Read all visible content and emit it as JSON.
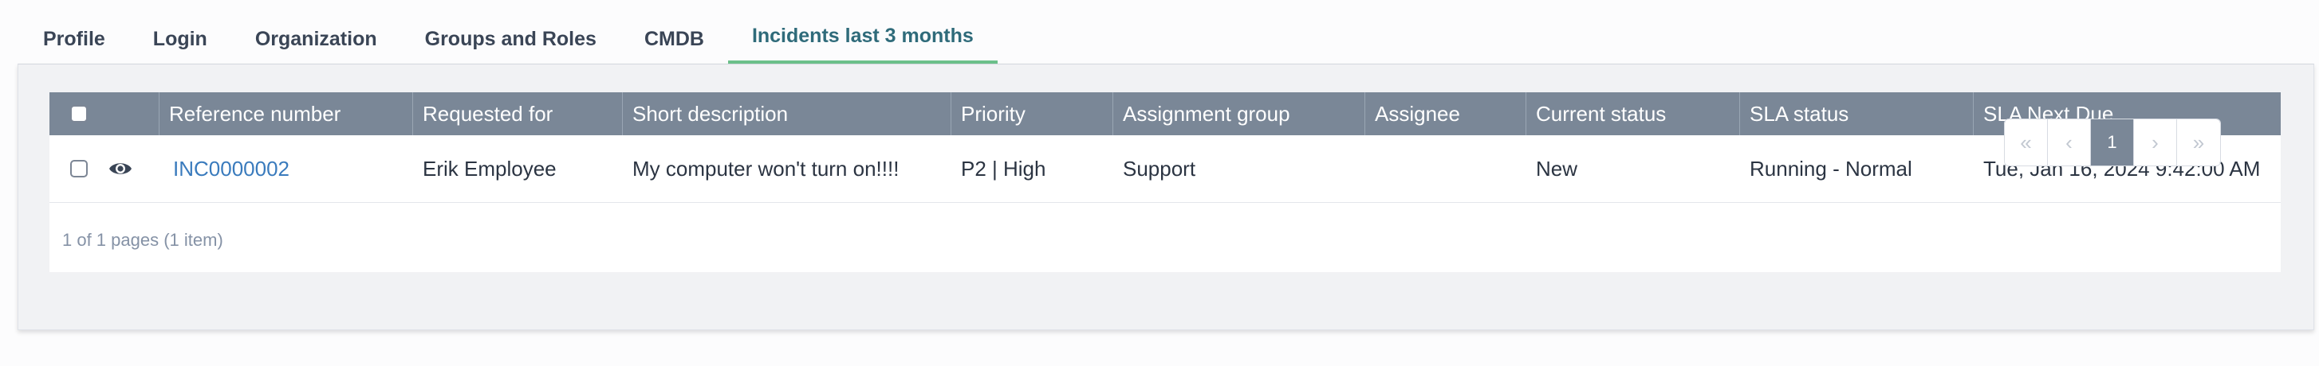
{
  "tabs": [
    {
      "label": "Profile"
    },
    {
      "label": "Login"
    },
    {
      "label": "Organization"
    },
    {
      "label": "Groups and Roles"
    },
    {
      "label": "CMDB"
    },
    {
      "label": "Incidents last 3 months"
    }
  ],
  "active_tab": "Incidents last 3 months",
  "table": {
    "columns": [
      "Reference number",
      "Requested for",
      "Short description",
      "Priority",
      "Assignment group",
      "Assignee",
      "Current status",
      "SLA status",
      "SLA Next Due"
    ],
    "rows": [
      {
        "reference": "INC0000002",
        "requested_for": "Erik Employee",
        "short_description": "My computer won't turn on!!!!",
        "priority": "P2 | High",
        "assignment_group": "Support",
        "assignee": "",
        "current_status": "New",
        "sla_status": "Running - Normal",
        "sla_next_due": "Tue, Jan 16, 2024 9:42:00 AM"
      }
    ]
  },
  "pagination": {
    "info": "1 of 1 pages (1 item)",
    "first": "«",
    "prev": "‹",
    "current": "1",
    "next": "›",
    "last": "»"
  },
  "colors": {
    "header_bg": "#7a8797",
    "link": "#3a7bbd",
    "active_tab_underline": "#6cc08a"
  }
}
